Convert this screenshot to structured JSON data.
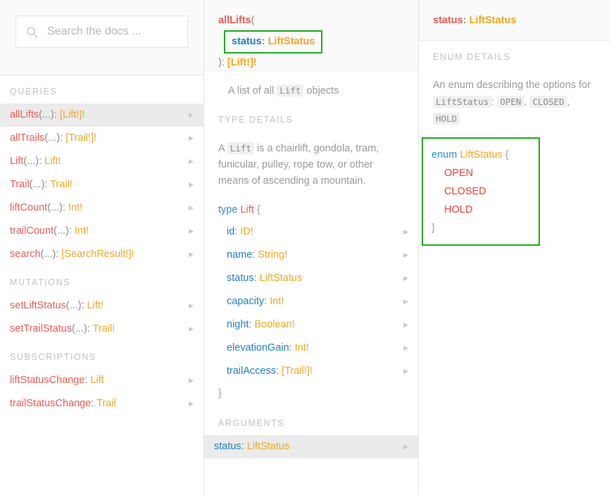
{
  "search": {
    "placeholder": "Search the docs ...",
    "value": "",
    "icon": "search-icon"
  },
  "sidebar": {
    "sections": [
      {
        "title": "QUERIES",
        "items": [
          {
            "name": "allLifts",
            "args": "(...)",
            "sep": ": ",
            "type": "[Lift!]!",
            "selected": true
          },
          {
            "name": "allTrails",
            "args": "(...)",
            "sep": ": ",
            "type": "[Trail!]!",
            "selected": false
          },
          {
            "name": "Lift",
            "args": "(...)",
            "sep": ": ",
            "type": "Lift!",
            "selected": false
          },
          {
            "name": "Trail",
            "args": "(...)",
            "sep": ": ",
            "type": "Trail!",
            "selected": false
          },
          {
            "name": "liftCount",
            "args": "(...)",
            "sep": ": ",
            "type": "Int!",
            "selected": false
          },
          {
            "name": "trailCount",
            "args": "(...)",
            "sep": ": ",
            "type": "Int!",
            "selected": false
          },
          {
            "name": "search",
            "args": "(...)",
            "sep": ": ",
            "type": "[SearchResult!]!",
            "selected": false
          }
        ]
      },
      {
        "title": "MUTATIONS",
        "items": [
          {
            "name": "setLiftStatus",
            "args": "(...)",
            "sep": ": ",
            "type": "Lift!",
            "selected": false
          },
          {
            "name": "setTrailStatus",
            "args": "(...)",
            "sep": ": ",
            "type": "Trail!",
            "selected": false
          }
        ]
      },
      {
        "title": "SUBSCRIPTIONS",
        "items": [
          {
            "name": "liftStatusChange",
            "args": "",
            "sep": ": ",
            "type": "Lift",
            "selected": false
          },
          {
            "name": "trailStatusChange",
            "args": "",
            "sep": ": ",
            "type": "Trail",
            "selected": false
          }
        ]
      }
    ],
    "caret": "▶"
  },
  "middle": {
    "signature": {
      "name": "allLifts",
      "open_paren": "(",
      "arg_name": "status",
      "arg_sep": ": ",
      "arg_type": "LiftStatus",
      "close": "): ",
      "return_type": "[Lift!]!"
    },
    "description": {
      "before": "A list of all ",
      "code": "Lift",
      "after": " objects"
    },
    "type_details": {
      "title": "TYPE DETAILS",
      "desc_before": "A ",
      "desc_code": "Lift",
      "desc_after": " is a chairlift, gondola, tram, funicular, pulley, rope tow, or other means of ascending a mountain.",
      "keyword": "type",
      "type_name": "Lift",
      "open_brace": "{",
      "close_brace": "}",
      "fields": [
        {
          "name": "id",
          "sep": ": ",
          "type": "ID!"
        },
        {
          "name": "name",
          "sep": ": ",
          "type": "String!"
        },
        {
          "name": "status",
          "sep": ": ",
          "type": "LiftStatus"
        },
        {
          "name": "capacity",
          "sep": ": ",
          "type": "Int!"
        },
        {
          "name": "night",
          "sep": ": ",
          "type": "Boolean!"
        },
        {
          "name": "elevationGain",
          "sep": ": ",
          "type": "Int!"
        },
        {
          "name": "trailAccess",
          "sep": ": ",
          "type": "[Trail!]!"
        }
      ]
    },
    "arguments": {
      "title": "ARGUMENTS",
      "items": [
        {
          "name": "status",
          "sep": ": ",
          "type": "LiftStatus",
          "selected": true
        }
      ]
    }
  },
  "right": {
    "signature": {
      "name": "status",
      "sep": ": ",
      "type": "LiftStatus"
    },
    "enum_details": {
      "title": "ENUM DETAILS",
      "desc_before": "An enum describing the options for ",
      "desc_code": "LiftStatus",
      "desc_colon": ": ",
      "value_codes": [
        "OPEN",
        "CLOSED",
        "HOLD"
      ],
      "keyword": "enum",
      "type_name": "LiftStatus",
      "open_brace": "{",
      "close_brace": "}",
      "values": [
        "OPEN",
        "CLOSED",
        "HOLD"
      ]
    }
  },
  "colors": {
    "field": "#f25c54",
    "argument": "#1f81c2",
    "type": "#f5a623",
    "keyword": "#2b8fd4",
    "enum_value": "#ef4136",
    "annotation_border": "#22aa22",
    "selected_row": "#ebebeb",
    "panel_header_bg": "#fafafa"
  }
}
